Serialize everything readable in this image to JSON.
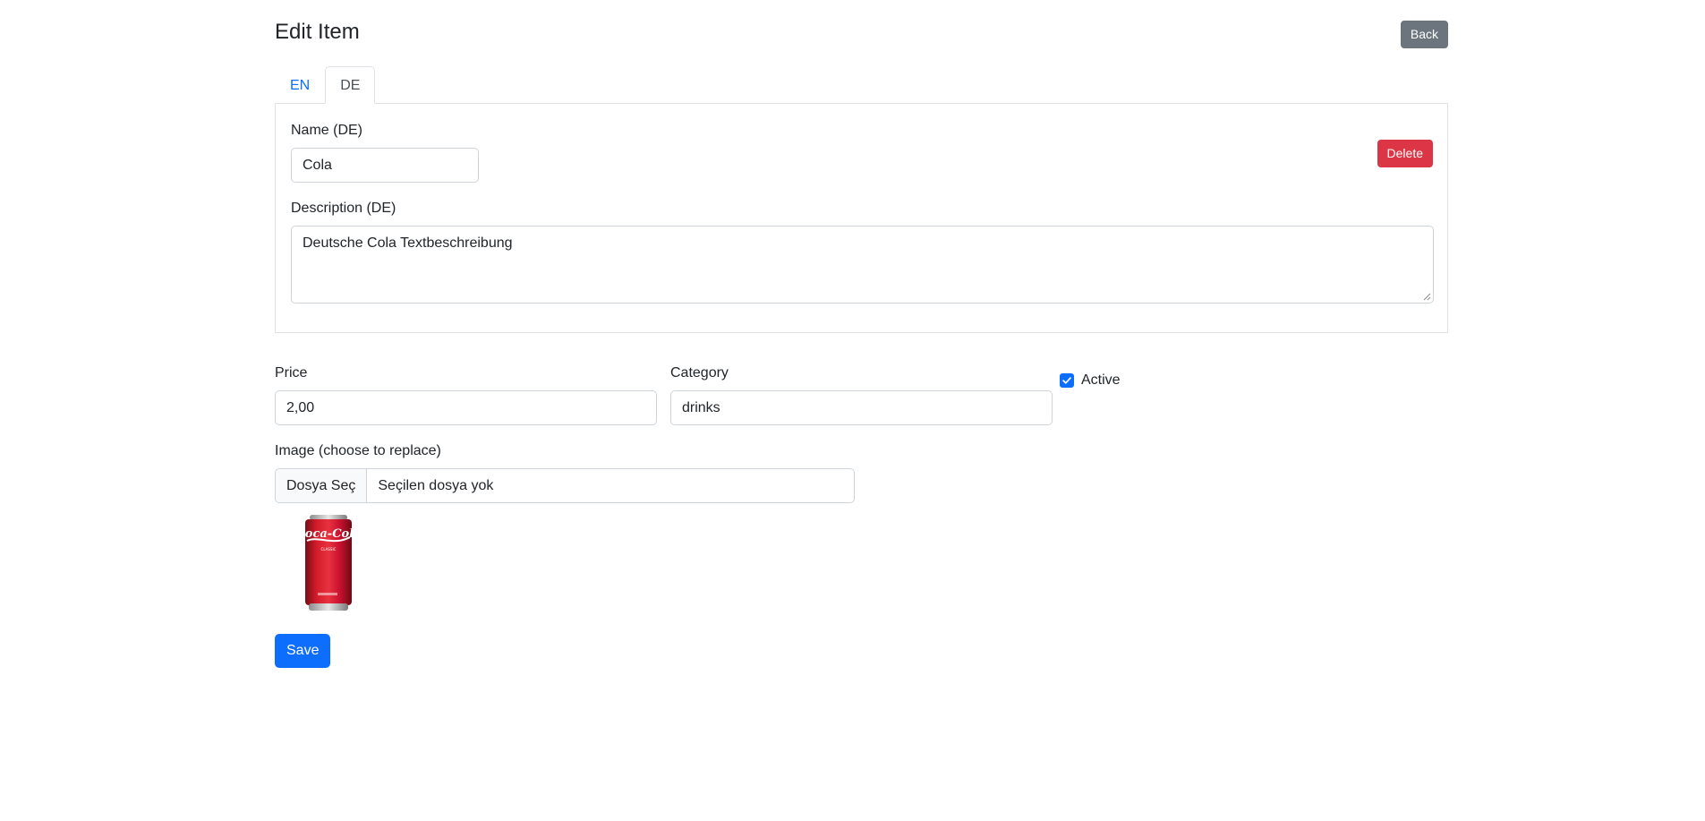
{
  "page": {
    "title": "Edit Item",
    "back_label": "Back"
  },
  "tabs": [
    {
      "label": "EN",
      "active": false
    },
    {
      "label": "DE",
      "active": true
    }
  ],
  "translation": {
    "name_label": "Name (DE)",
    "name_value": "Cola",
    "description_label": "Description (DE)",
    "description_value": "Deutsche Cola Textbeschreibung",
    "delete_label": "Delete"
  },
  "details": {
    "price_label": "Price",
    "price_value": "2,00",
    "category_label": "Category",
    "category_value": "drinks",
    "active_label": "Active",
    "active_checked": true
  },
  "image": {
    "label": "Image (choose to replace)",
    "file_button": "Dosya Seç",
    "file_status": "Seçilen dosya yok",
    "thumbnail": {
      "logo_text": "Coca-Cola",
      "sub_text": "CLASSIC"
    }
  },
  "actions": {
    "save_label": "Save"
  },
  "colors": {
    "primary": "#0d6efd",
    "danger": "#dc3545",
    "secondary": "#6c757d",
    "can_red": "#c8102e"
  }
}
